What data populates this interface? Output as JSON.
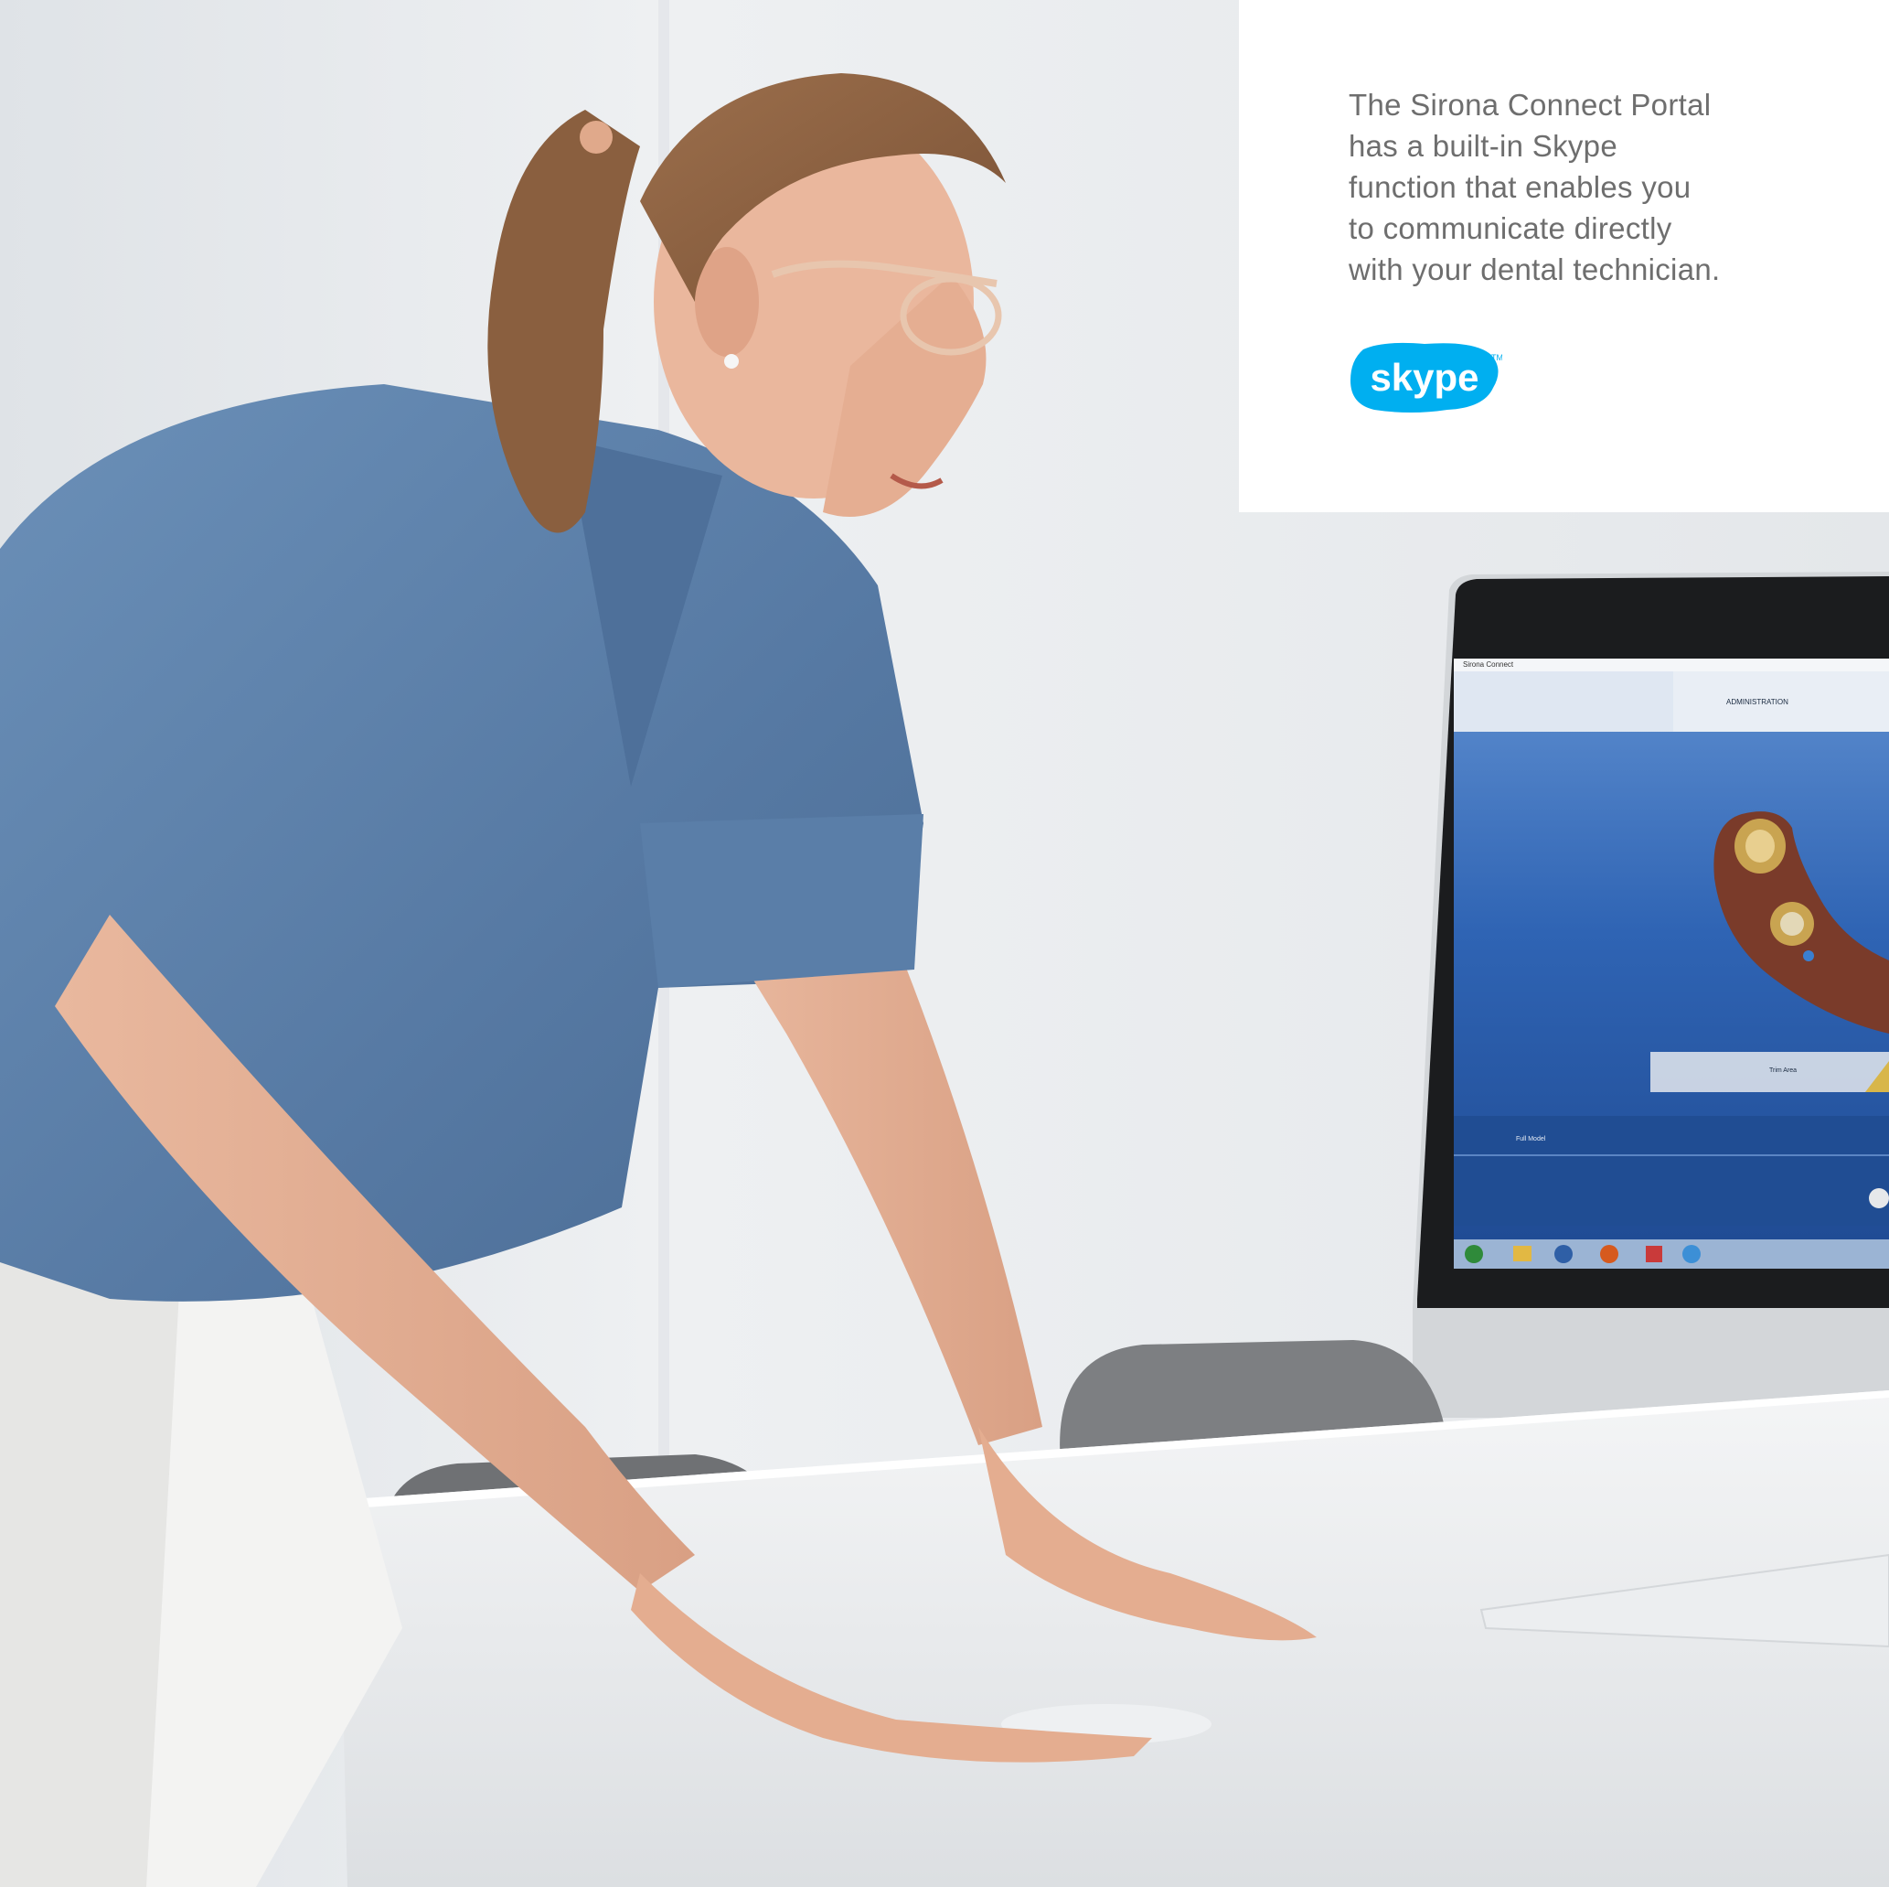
{
  "card": {
    "lines": [
      "The Sirona Connect Portal",
      "has a built-in Skype",
      "function that enables you",
      "to communicate directly",
      "with your dental technician."
    ],
    "logo_text": "skype",
    "logo_color": "#00aff0"
  },
  "monitor": {
    "window_title": "Sirona Connect",
    "tab_administration": "ADMINISTRATION",
    "step_label": "Trim Area",
    "side_label": "Full Model",
    "taskbar_icons": [
      "start-icon",
      "folder-icon",
      "app-icon",
      "firefox-icon",
      "tool-icon",
      "globe-icon"
    ]
  },
  "colors": {
    "scrubs": "#5b82ad",
    "wall": "#e6e9ec",
    "screen_blue": "#2f64b4",
    "card": "#ffffff",
    "text_gray": "#6e6e6e"
  }
}
